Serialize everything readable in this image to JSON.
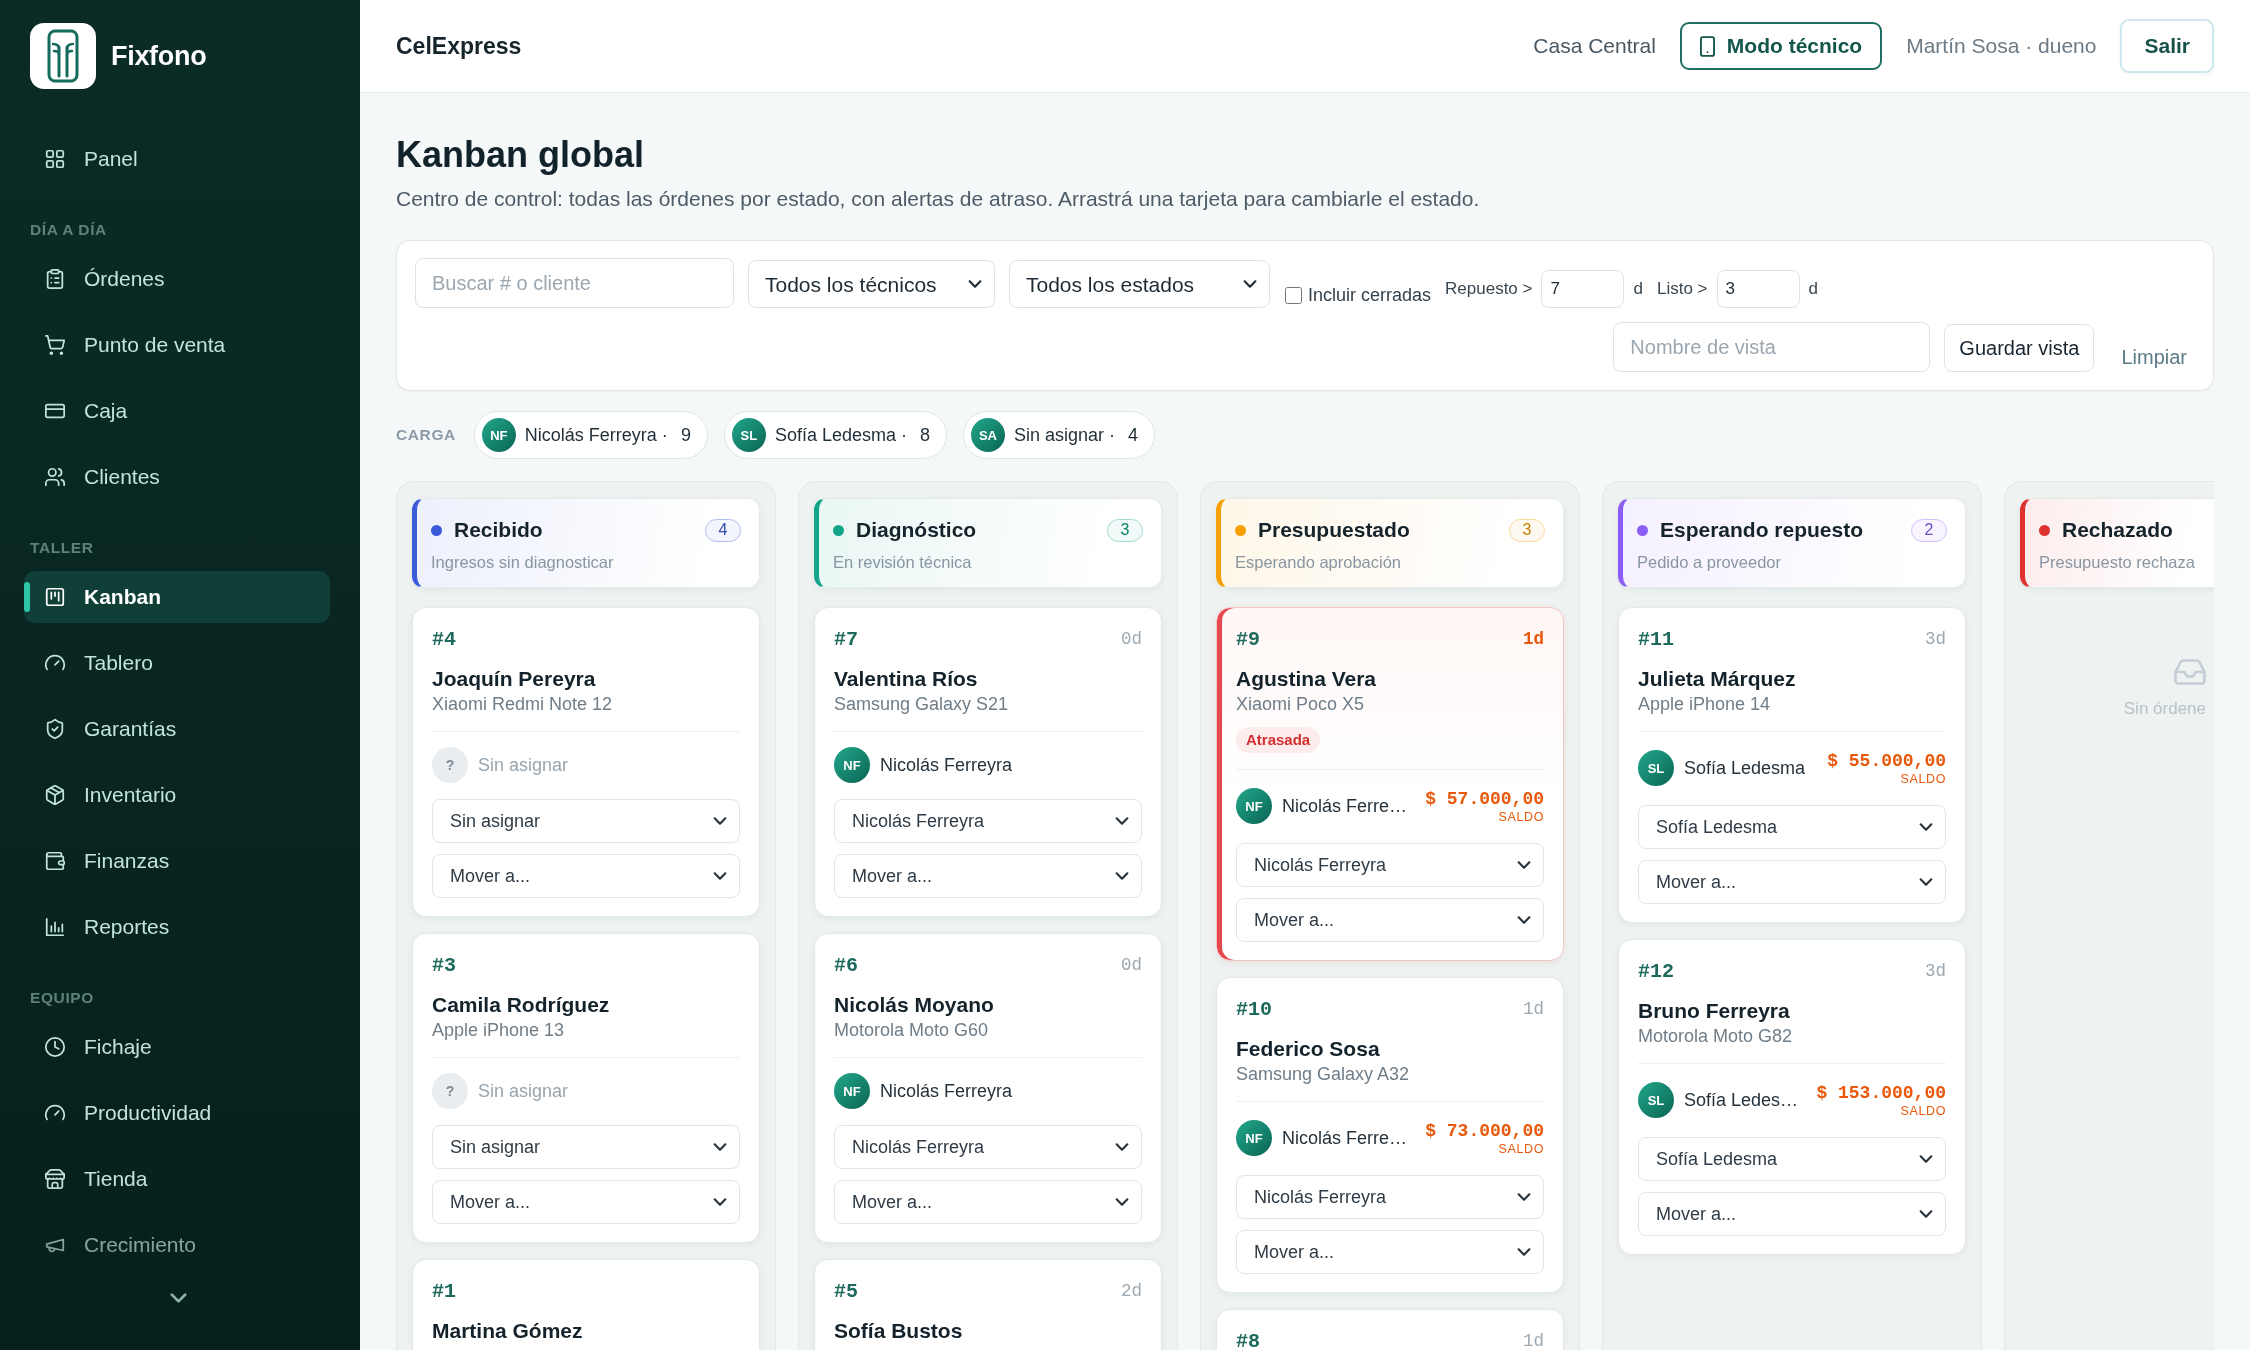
{
  "sidebar": {
    "brand": "Fixfono",
    "sections": [
      {
        "items": [
          {
            "label": "Panel",
            "selected": false
          }
        ]
      },
      {
        "title": "DÍA A DÍA",
        "items": [
          {
            "label": "Órdenes",
            "selected": false
          },
          {
            "label": "Punto de venta",
            "selected": false
          },
          {
            "label": "Caja",
            "selected": false
          },
          {
            "label": "Clientes",
            "selected": false
          }
        ]
      },
      {
        "title": "TALLER",
        "items": [
          {
            "label": "Kanban",
            "selected": true
          },
          {
            "label": "Tablero",
            "selected": false
          },
          {
            "label": "Garantías",
            "selected": false
          },
          {
            "label": "Inventario",
            "selected": false
          },
          {
            "label": "Finanzas",
            "selected": false
          },
          {
            "label": "Reportes",
            "selected": false
          }
        ]
      },
      {
        "title": "EQUIPO",
        "items": [
          {
            "label": "Fichaje",
            "selected": false
          },
          {
            "label": "Productividad",
            "selected": false
          },
          {
            "label": "Tienda",
            "selected": false
          },
          {
            "label": "Crecimiento",
            "selected": false
          }
        ]
      }
    ]
  },
  "topbar": {
    "store": "CelExpress",
    "branch": "Casa Central",
    "mode_button": "Modo técnico",
    "user": "Martín Sosa · dueno",
    "logout_button": "Salir"
  },
  "page": {
    "title": "Kanban global",
    "subtitle": "Centro de control: todas las órdenes por estado, con alertas de atraso. Arrastrá una tarjeta para cambiarle el estado."
  },
  "filters": {
    "search": {
      "placeholder": "Buscar # o cliente"
    },
    "technician": "Todos los técnicos",
    "status": "Todos los estados",
    "include_closed": {
      "label": "Incluir cerradas",
      "checked": false
    },
    "thresholds": [
      {
        "label": "Repuesto >",
        "value": "7",
        "unit": "d"
      },
      {
        "label": "Listo >",
        "value": "3",
        "unit": "d"
      }
    ],
    "view_name": {
      "placeholder": "Nombre de vista"
    },
    "save_button": "Guardar vista",
    "clear_link": "Limpiar"
  },
  "workload": {
    "label": "CARGA",
    "chips": [
      {
        "initials": "NF",
        "name": "Nicolás Ferreyra ·",
        "count": "9"
      },
      {
        "initials": "SL",
        "name": "Sofía Ledesma ·",
        "count": "8"
      },
      {
        "initials": "SA",
        "name": "Sin asignar ·",
        "count": "4"
      }
    ]
  },
  "board": {
    "columns": [
      {
        "title": "Recibido",
        "subtitle": "Ingresos sin diagnosticar",
        "count": "4",
        "color": "#3b5bdb",
        "cards": [
          {
            "id": "#4",
            "customer": "Joaquín Pereyra",
            "device": "Xiaomi Redmi Note 12",
            "overdue": false,
            "assignee": {
              "kind": "unassigned",
              "initials": "?",
              "name": "Sin asignar"
            },
            "assign_select": "Sin asignar",
            "move_select": "Mover a..."
          },
          {
            "id": "#3",
            "customer": "Camila Rodríguez",
            "device": "Apple iPhone 13",
            "overdue": false,
            "assignee": {
              "kind": "unassigned",
              "initials": "?",
              "name": "Sin asignar"
            },
            "assign_select": "Sin asignar",
            "move_select": "Mover a..."
          },
          {
            "id": "#1",
            "customer": "Martina Gómez",
            "overdue": false
          }
        ]
      },
      {
        "title": "Diagnóstico",
        "subtitle": "En revisión técnica",
        "count": "3",
        "color": "#12a58a",
        "cards": [
          {
            "id": "#7",
            "age": "0d",
            "customer": "Valentina Ríos",
            "device": "Samsung Galaxy S21",
            "overdue": false,
            "assignee": {
              "kind": "technician",
              "initials": "NF",
              "name": "Nicolás Ferreyra"
            },
            "assign_select": "Nicolás Ferreyra",
            "move_select": "Mover a..."
          },
          {
            "id": "#6",
            "age": "0d",
            "customer": "Nicolás Moyano",
            "device": "Motorola Moto G60",
            "overdue": false,
            "assignee": {
              "kind": "technician",
              "initials": "NF",
              "name": "Nicolás Ferreyra"
            },
            "assign_select": "Nicolás Ferreyra",
            "move_select": "Mover a..."
          },
          {
            "id": "#5",
            "age": "2d",
            "customer": "Sofía Bustos",
            "overdue": false
          }
        ]
      },
      {
        "title": "Presupuestado",
        "subtitle": "Esperando aprobación",
        "count": "3",
        "color": "#f59f00",
        "cards": [
          {
            "id": "#9",
            "age": "1d",
            "customer": "Agustina Vera",
            "device": "Xiaomi Poco X5",
            "badge": "Atrasada",
            "overdue": true,
            "assignee": {
              "kind": "technician",
              "initials": "NF",
              "name": "Nicolás Ferre…"
            },
            "balance": {
              "amount": "$ 57.000,00",
              "label": "SALDO"
            },
            "assign_select": "Nicolás Ferreyra",
            "move_select": "Mover a..."
          },
          {
            "id": "#10",
            "age": "1d",
            "customer": "Federico Sosa",
            "device": "Samsung Galaxy A32",
            "overdue": false,
            "assignee": {
              "kind": "technician",
              "initials": "NF",
              "name": "Nicolás Ferre…"
            },
            "balance": {
              "amount": "$ 73.000,00",
              "label": "SALDO"
            },
            "assign_select": "Nicolás Ferreyra",
            "move_select": "Mover a..."
          },
          {
            "id": "#8",
            "age": "1d",
            "overdue": false
          }
        ]
      },
      {
        "title": "Esperando repuesto",
        "subtitle": "Pedido a proveedor",
        "count": "2",
        "color": "#8b5cf6",
        "cards": [
          {
            "id": "#11",
            "age": "3d",
            "customer": "Julieta Márquez",
            "device": "Apple iPhone 14",
            "overdue": false,
            "assignee": {
              "kind": "technician",
              "initials": "SL",
              "name": "Sofía Ledesma"
            },
            "balance": {
              "amount": "$ 55.000,00",
              "label": "SALDO"
            },
            "assign_select": "Sofía Ledesma",
            "move_select": "Mover a..."
          },
          {
            "id": "#12",
            "age": "3d",
            "customer": "Bruno Ferreyra",
            "device": "Motorola Moto G82",
            "overdue": false,
            "assignee": {
              "kind": "technician",
              "initials": "SL",
              "name": "Sofía Ledes…"
            },
            "balance": {
              "amount": "$ 153.000,00",
              "label": "SALDO"
            },
            "assign_select": "Sofía Ledesma",
            "move_select": "Mover a..."
          }
        ]
      },
      {
        "title": "Rechazado",
        "subtitle": "Presupuesto rechaza",
        "color": "#e03131",
        "empty_text": "Sin órdene"
      }
    ]
  }
}
